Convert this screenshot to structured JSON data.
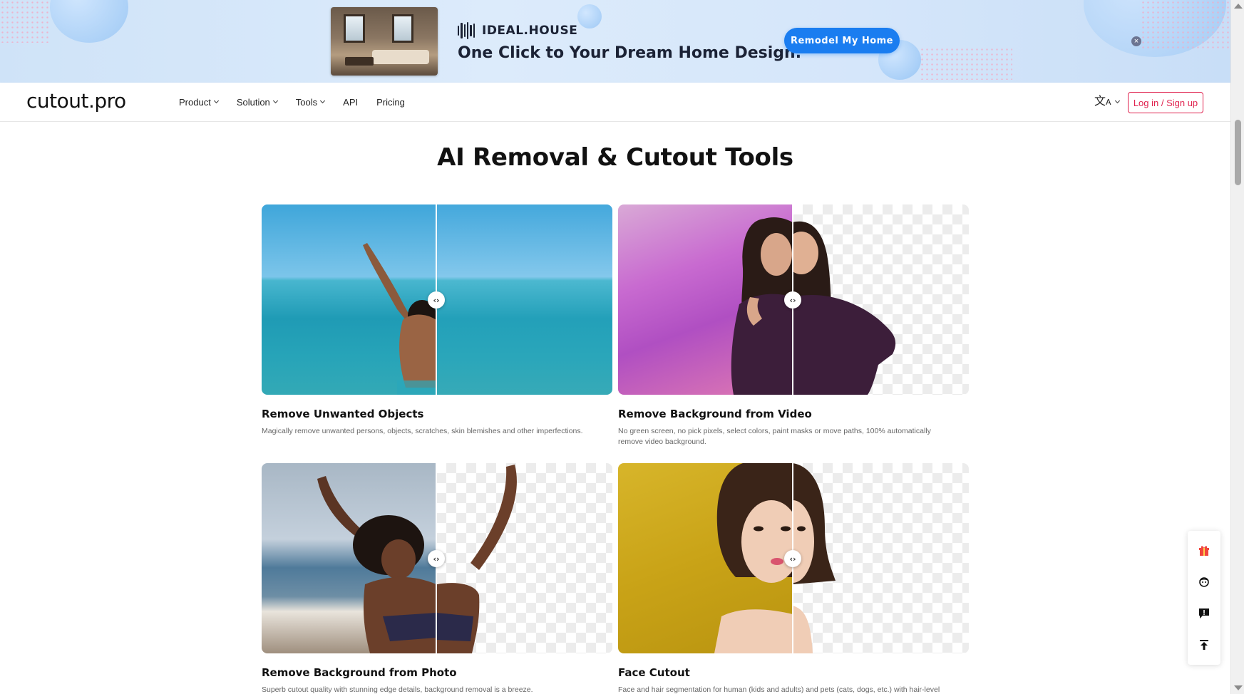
{
  "ad": {
    "brand": "IDEAL.HOUSE",
    "tagline": "One Click to Your Dream Home Design.",
    "cta": "Remodel My Home",
    "close_icon": "close-icon"
  },
  "nav": {
    "logo": "cutout.pro",
    "items": [
      {
        "label": "Product",
        "has_dropdown": true
      },
      {
        "label": "Solution",
        "has_dropdown": true
      },
      {
        "label": "Tools",
        "has_dropdown": true
      },
      {
        "label": "API",
        "has_dropdown": false
      },
      {
        "label": "Pricing",
        "has_dropdown": false
      }
    ],
    "language_icon": "translate-icon",
    "login": "Log in / Sign up"
  },
  "main": {
    "title": "AI Removal & Cutout Tools",
    "cards": [
      {
        "title": "Remove Unwanted Objects",
        "desc": "Magically remove unwanted persons, objects, scratches, skin blemishes and other imperfections."
      },
      {
        "title": "Remove Background from Video",
        "desc": "No green screen, no pick pixels, select colors, paint masks or move paths, 100% automatically remove video background."
      },
      {
        "title": "Remove Background from Photo",
        "desc": "Superb cutout quality with stunning edge details, background removal is a breeze."
      },
      {
        "title": "Face Cutout",
        "desc": "Face and hair segmentation for human (kids and adults) and pets (cats, dogs, etc.) with hair-level"
      }
    ],
    "compare_handle": "‹›"
  },
  "side_widget": {
    "icons": [
      "gift-icon",
      "support-agent-icon",
      "feedback-icon",
      "back-to-top-icon"
    ]
  },
  "colors": {
    "accent": "#e0224e",
    "ad_button": "#1a7df0"
  }
}
